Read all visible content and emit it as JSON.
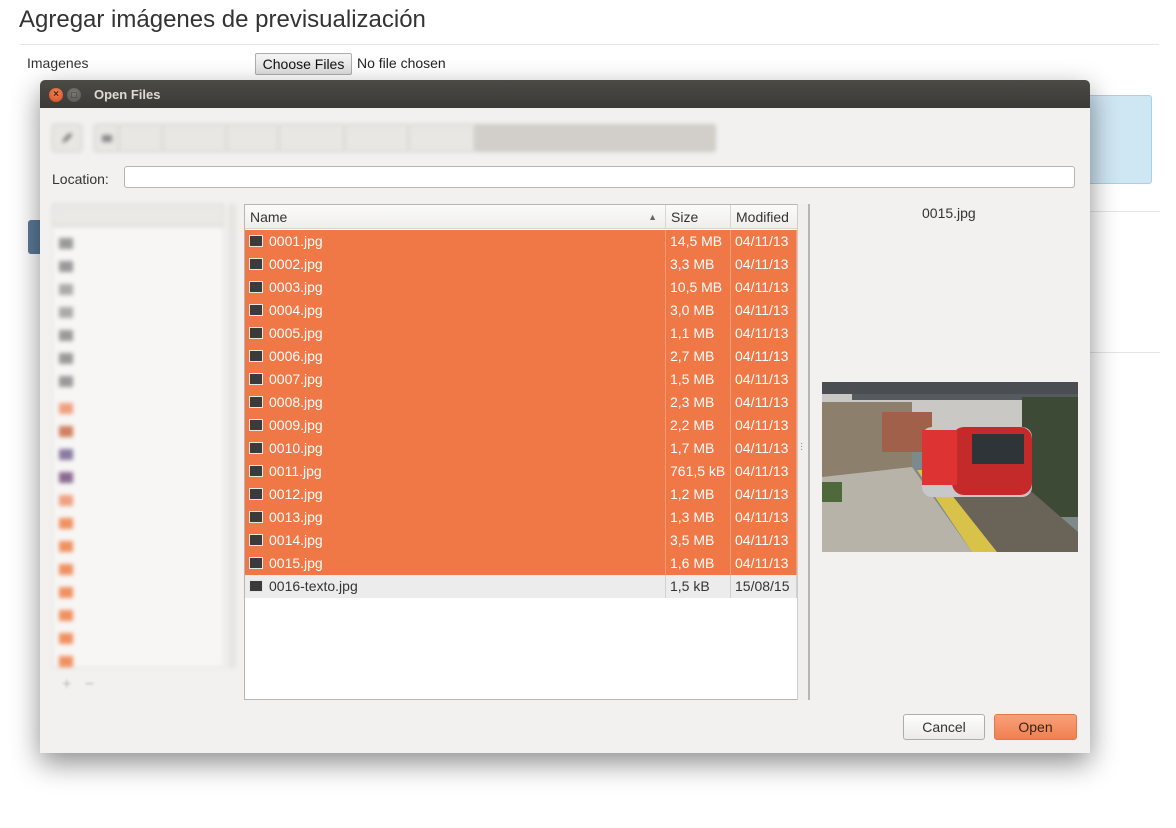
{
  "page": {
    "title": "Agregar imágenes de previsualización",
    "field_label": "Imagenes",
    "choose_button": "Choose Files",
    "no_file_text": "No file chosen"
  },
  "dialog": {
    "title": "Open Files",
    "window_buttons": {
      "close_glyph": "×",
      "maximize_glyph": "□"
    },
    "location_label": "Location:",
    "location_value": "",
    "columns": {
      "name": "Name",
      "size": "Size",
      "modified": "Modified"
    },
    "files": [
      {
        "name": "0001.jpg",
        "size": "14,5 MB",
        "modified": "04/11/13",
        "selected": true
      },
      {
        "name": "0002.jpg",
        "size": "3,3 MB",
        "modified": "04/11/13",
        "selected": true
      },
      {
        "name": "0003.jpg",
        "size": "10,5 MB",
        "modified": "04/11/13",
        "selected": true
      },
      {
        "name": "0004.jpg",
        "size": "3,0 MB",
        "modified": "04/11/13",
        "selected": true
      },
      {
        "name": "0005.jpg",
        "size": "1,1 MB",
        "modified": "04/11/13",
        "selected": true
      },
      {
        "name": "0006.jpg",
        "size": "2,7 MB",
        "modified": "04/11/13",
        "selected": true
      },
      {
        "name": "0007.jpg",
        "size": "1,5 MB",
        "modified": "04/11/13",
        "selected": true
      },
      {
        "name": "0008.jpg",
        "size": "2,3 MB",
        "modified": "04/11/13",
        "selected": true
      },
      {
        "name": "0009.jpg",
        "size": "2,2 MB",
        "modified": "04/11/13",
        "selected": true
      },
      {
        "name": "0010.jpg",
        "size": "1,7 MB",
        "modified": "04/11/13",
        "selected": true
      },
      {
        "name": "0011.jpg",
        "size": "761,5 kB",
        "modified": "04/11/13",
        "selected": true
      },
      {
        "name": "0012.jpg",
        "size": "1,2 MB",
        "modified": "04/11/13",
        "selected": true
      },
      {
        "name": "0013.jpg",
        "size": "1,3 MB",
        "modified": "04/11/13",
        "selected": true
      },
      {
        "name": "0014.jpg",
        "size": "3,5 MB",
        "modified": "04/11/13",
        "selected": true
      },
      {
        "name": "0015.jpg",
        "size": "1,6 MB",
        "modified": "04/11/13",
        "selected": true
      },
      {
        "name": "0016-texto.jpg",
        "size": "1,5 kB",
        "modified": "15/08/15",
        "selected": false
      }
    ],
    "preview_filename": "0015.jpg",
    "cancel_label": "Cancel",
    "open_label": "Open",
    "colors": {
      "selection": "#f07746",
      "titlebar": "#3b3a36",
      "open_button": "#f0804f"
    }
  }
}
